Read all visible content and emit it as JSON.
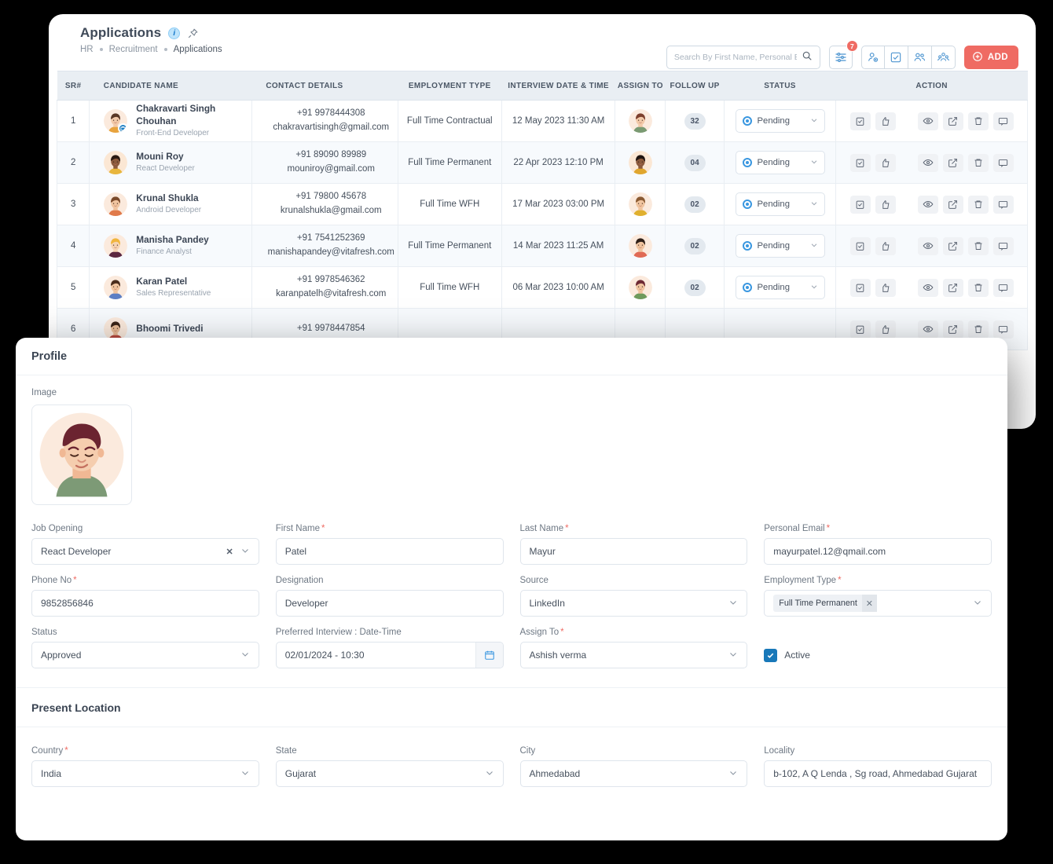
{
  "header": {
    "title": "Applications",
    "info_icon": "info-icon",
    "pin_icon": "pin-icon",
    "breadcrumb": [
      "HR",
      "Recruitment",
      "Applications"
    ]
  },
  "toolbar": {
    "search_placeholder": "Search By First Name, Personal Em",
    "search_value": "",
    "search_icon": "search-icon",
    "filter_icon": "filter-icon",
    "filter_badge": "7",
    "icons": [
      "user-add-icon",
      "checkbox-task-icon",
      "users-icon",
      "team-group-icon"
    ],
    "add_label": "ADD"
  },
  "table": {
    "columns": [
      "SR#",
      "CANDIDATE NAME",
      "CONTACT DETAILS",
      "EMPLOYMENT TYPE",
      "INTERVIEW DATE & TIME",
      "ASSIGN TO",
      "FOLLOW UP",
      "STATUS",
      "ACTION"
    ],
    "action_icons": [
      "clipboard-check-icon",
      "thumbs-up-icon",
      "eye-icon",
      "edit-icon",
      "trash-icon",
      "comment-icon"
    ],
    "status_chevron": "chevron-down-icon",
    "rows": [
      {
        "sr": "1",
        "name": "Chakravarti Singh Chouhan",
        "role": "Front-End Developer",
        "phone": "+91 9978444308",
        "email": "chakravartisingh@gmail.com",
        "employment": "Full Time Contractual",
        "interview": "12 May 2023 11:30 AM",
        "follow_up": "32",
        "status": "Pending",
        "avatar_skin": "#f2c9a8",
        "avatar_hair": "#5a3825",
        "avatar_shirt": "#e8a33d",
        "avatar_bg": "#fbeadd",
        "badge_icon": "briefcase-badge-icon"
      },
      {
        "sr": "2",
        "name": "Mouni Roy",
        "role": "React Developer",
        "phone": "+91 89090 89989",
        "email": "mouniroy@gmail.com",
        "employment": "Full Time Permanent",
        "interview": "22 Apr 2023 12:10 PM",
        "follow_up": "04",
        "status": "Pending",
        "avatar_skin": "#8c5a3c",
        "avatar_hair": "#2a1a12",
        "avatar_shirt": "#e8b63d",
        "avatar_bg": "#fbe7d4"
      },
      {
        "sr": "3",
        "name": "Krunal Shukla",
        "role": "Android Developer",
        "phone": "+91 79800 45678",
        "email": "krunalshukla@gmail.com",
        "employment": "Full Time WFH",
        "interview": "17 Mar 2023 03:00 PM",
        "follow_up": "02",
        "status": "Pending",
        "avatar_skin": "#f0c49f",
        "avatar_hair": "#7a4a2a",
        "avatar_shirt": "#e07a4a",
        "avatar_bg": "#fbeadd"
      },
      {
        "sr": "4",
        "name": "Manisha Pandey",
        "role": "Finance Analyst",
        "phone": "+91 7541252369",
        "email": "manishapandey@vitafresh.com",
        "employment": "Full Time Permanent",
        "interview": "14 Mar 2023 11:25 AM",
        "follow_up": "02",
        "status": "Pending",
        "avatar_skin": "#f6d3b2",
        "avatar_hair": "#f0b53e",
        "avatar_shirt": "#5b2740",
        "avatar_bg": "#fbeadd"
      },
      {
        "sr": "5",
        "name": "Karan Patel",
        "role": "Sales Representative",
        "phone": "+91 9978546362",
        "email": "karanpatelh@vitafresh.com",
        "employment": "Full Time WFH",
        "interview": "06 Mar 2023 10:00 AM",
        "follow_up": "02",
        "status": "Pending",
        "avatar_skin": "#f0c49f",
        "avatar_hair": "#4a2d1c",
        "avatar_shirt": "#5d7fc4",
        "avatar_bg": "#fbeadd"
      },
      {
        "sr": "6",
        "name": "Bhoomi Trivedi",
        "role": "",
        "phone": "+91 9978447854",
        "email": "",
        "employment": "",
        "interview": "",
        "follow_up": "",
        "status": "",
        "avatar_skin": "#e8bb96",
        "avatar_hair": "#3a2418",
        "avatar_shirt": "#b8493f",
        "avatar_bg": "#fbeadd"
      }
    ],
    "assign_avatars": [
      {
        "skin": "#f2c9a8",
        "hair": "#7d3f2c",
        "shirt": "#7a9a72",
        "bg": "#fbeadd"
      },
      {
        "skin": "#8c5a3c",
        "hair": "#1f1410",
        "shirt": "#e0a62e",
        "bg": "#fbe7d4"
      },
      {
        "skin": "#f0c49f",
        "hair": "#8a5a32",
        "shirt": "#e0b02e",
        "bg": "#fbeadd"
      },
      {
        "skin": "#f0c49f",
        "hair": "#2f2018",
        "shirt": "#e06a54",
        "bg": "#fbeadd"
      },
      {
        "skin": "#f0c49f",
        "hair": "#6e2a34",
        "shirt": "#6f9a5c",
        "bg": "#fbeadd"
      }
    ]
  },
  "modal": {
    "title": "Profile",
    "image_label": "Image",
    "avatar": {
      "skin": "#f5cdae",
      "hair": "#6b2430",
      "shirt": "#7d9a76",
      "bg": "#fbeadd"
    },
    "fields": [
      {
        "label": "Job Opening",
        "required": false,
        "value": "React Developer",
        "type": "select-clear"
      },
      {
        "label": "First Name",
        "required": true,
        "value": "Patel",
        "type": "text"
      },
      {
        "label": "Last Name",
        "required": true,
        "value": "Mayur",
        "type": "text"
      },
      {
        "label": "Personal Email",
        "required": true,
        "value": "mayurpatel.12@qmail.com",
        "type": "text"
      },
      {
        "label": "Phone No",
        "required": true,
        "value": "9852856846",
        "type": "text"
      },
      {
        "label": "Designation",
        "required": false,
        "value": "Developer",
        "type": "text"
      },
      {
        "label": "Source",
        "required": false,
        "value": "LinkedIn",
        "type": "select"
      },
      {
        "label": "Employment Type",
        "required": true,
        "value": "Full Time Permanent",
        "type": "tag-select"
      },
      {
        "label": "Status",
        "required": false,
        "value": "Approved",
        "type": "select"
      },
      {
        "label": "Preferred Interview : Date-Time",
        "required": false,
        "value": "02/01/2024 - 10:30",
        "type": "date"
      },
      {
        "label": "Assign To",
        "required": true,
        "value": "Ashish verma",
        "type": "select"
      },
      {
        "label": "",
        "required": false,
        "value": "Active",
        "type": "checkbox",
        "checked": true
      }
    ],
    "location": {
      "title": "Present Location",
      "fields": [
        {
          "label": "Country",
          "required": true,
          "value": "India",
          "type": "select"
        },
        {
          "label": "State",
          "required": false,
          "value": "Gujarat",
          "type": "select"
        },
        {
          "label": "City",
          "required": false,
          "value": "Ahmedabad",
          "type": "select"
        },
        {
          "label": "Locality",
          "required": false,
          "value": "b-102, A Q Lenda , Sg road, Ahmedabad  Gujarat",
          "type": "text"
        }
      ]
    },
    "calendar_icon": "calendar-icon",
    "chevron_icon": "chevron-down-icon",
    "clear_icon": "clear-x-icon",
    "check_icon": "check-icon"
  },
  "colors": {
    "accent_red": "#ef6b63",
    "accent_blue": "#3a97e0",
    "header_bg": "#e9eef3",
    "page_bg": "#000000"
  }
}
